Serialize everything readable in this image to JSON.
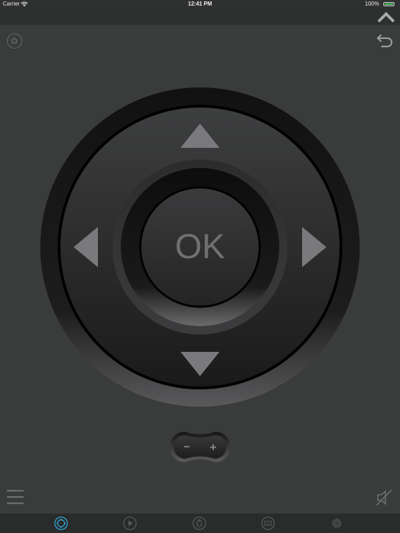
{
  "status_bar": {
    "carrier": "Carrier",
    "time": "12:41 PM",
    "battery": "100%",
    "battery_level": 1.0
  },
  "remote": {
    "ok_label": "OK",
    "volume": {
      "minus": "−",
      "plus": "+"
    }
  },
  "tabbar": {
    "tabs": [
      {
        "icon": "gamepad-icon",
        "active": true
      },
      {
        "icon": "play-icon",
        "active": false
      },
      {
        "icon": "mouse-icon",
        "active": false
      },
      {
        "icon": "keyboard-icon",
        "active": false
      },
      {
        "icon": "gear-icon",
        "active": false
      }
    ]
  },
  "colors": {
    "background": "#3a3b3b",
    "topbar": "#2e2f2f",
    "tabbar": "#2a2b2b",
    "active_tab": "#2fa8d6",
    "inactive_icon": "#5a5b5b",
    "arrow": "#7a7a7c",
    "ok_text": "#6f7070"
  }
}
